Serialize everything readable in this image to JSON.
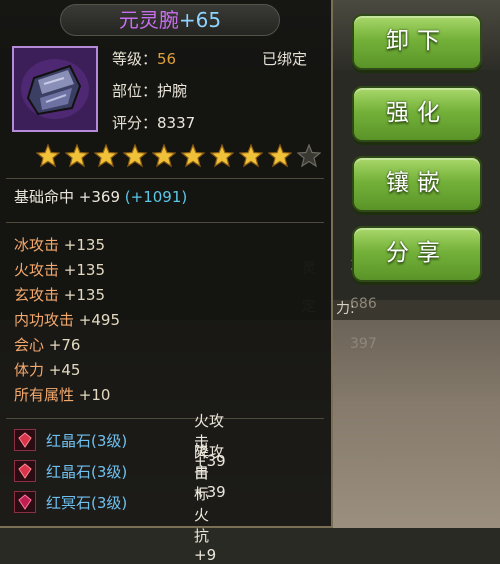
{
  "background": {
    "stats": [
      "325",
      "灵",
      "686",
      "定",
      "397",
      "力:"
    ]
  },
  "item": {
    "name": "元灵腕",
    "plus": "+65",
    "level_label": "等级：",
    "level_value": "56",
    "bound": "已绑定",
    "slot_label": "部位：",
    "slot_value": "护腕",
    "score_label": "评分：",
    "score_value": "8337",
    "stars_filled": 9,
    "stars_total": 10
  },
  "base_stat": {
    "label": "基础命中",
    "value": "+369",
    "bonus": "(+1091)"
  },
  "attributes": [
    {
      "name": "冰攻击",
      "value": "+135"
    },
    {
      "name": "火攻击",
      "value": "+135"
    },
    {
      "name": "玄攻击",
      "value": "+135"
    },
    {
      "name": "内功攻击",
      "value": "+495"
    },
    {
      "name": "会心",
      "value": "+76"
    },
    {
      "name": "体力",
      "value": "+45"
    },
    {
      "name": "所有属性",
      "value": "+10"
    }
  ],
  "gems": [
    {
      "name": "红晶石",
      "level": "(3级)",
      "effect": "火攻击+39"
    },
    {
      "name": "红晶石",
      "level": "(3级)",
      "effect": "火攻击+39"
    },
    {
      "name": "红冥石",
      "level": "(3级)",
      "effect": "降目标火抗+9"
    }
  ],
  "buttons": {
    "unequip": "卸下",
    "enhance": "强化",
    "inlay": "镶嵌",
    "share": "分享"
  },
  "colors": {
    "name": "#c86ff0",
    "button": "#74b13a",
    "level": "#e0a038",
    "bonus": "#5bc8ea"
  }
}
